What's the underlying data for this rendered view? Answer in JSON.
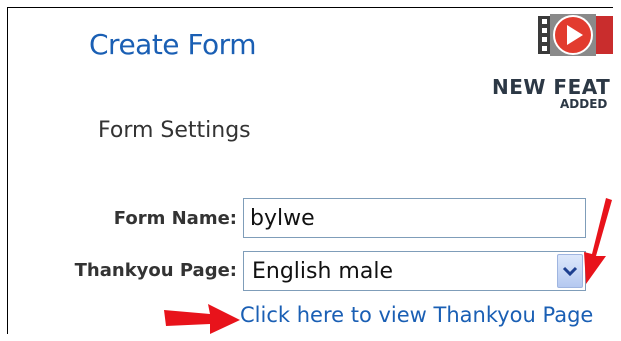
{
  "header": {
    "title": "Create Form",
    "promo": {
      "line1": "NEW  FEAT",
      "line2": "ADDED",
      "icon": "film-play-icon"
    }
  },
  "form": {
    "section_title": "Form Settings",
    "name_label": "Form Name:",
    "name_value": "bylwe",
    "thankyou_label": "Thankyou Page:",
    "thankyou_selected": "English male",
    "view_link": "Click here to view Thankyou Page"
  },
  "annotations": {
    "arrow_color": "#e8131b",
    "icons": [
      "red-arrow-icon",
      "red-arrow-icon"
    ]
  },
  "colors": {
    "title": "#1a5fb4",
    "link": "#1a5fb4",
    "label": "#333333"
  }
}
